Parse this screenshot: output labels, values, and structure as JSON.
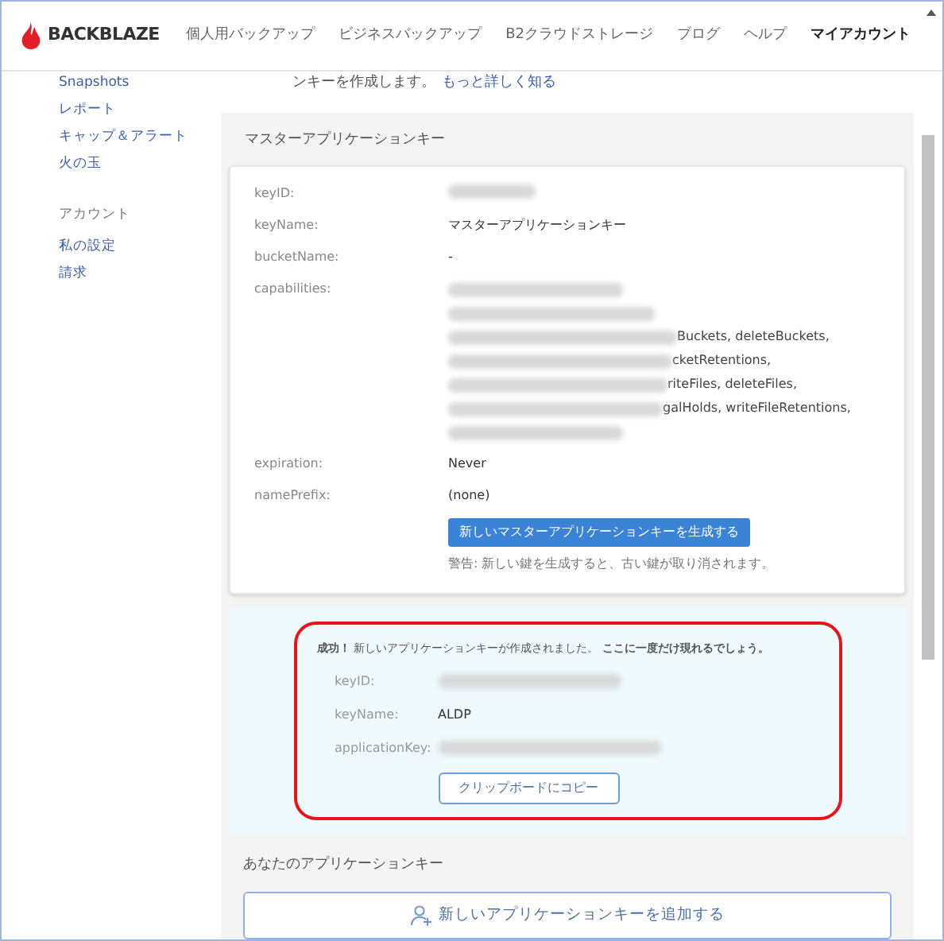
{
  "header": {
    "logo": "BACKBLAZE",
    "nav": [
      {
        "label": "個人用バックアップ",
        "selected": false
      },
      {
        "label": "ビジネスバックアップ",
        "selected": false
      },
      {
        "label": "B2クラウドストレージ",
        "selected": false
      },
      {
        "label": "ブログ",
        "selected": false
      },
      {
        "label": "ヘルプ",
        "selected": false
      },
      {
        "label": "マイアカウント",
        "selected": true
      }
    ]
  },
  "sidebar": {
    "groups": [
      {
        "items": [
          "Snapshots",
          "レポート",
          "キャップ＆アラート",
          "火の玉"
        ]
      },
      {
        "heading": "アカウント",
        "items": [
          "私の設定",
          "請求"
        ]
      }
    ]
  },
  "intro": {
    "text": "ンキーを作成します。",
    "link": "もっと詳しく知る"
  },
  "master_key": {
    "title": "マスターアプリケーションキー",
    "fields": [
      {
        "label": "keyID:",
        "kind": "redacted"
      },
      {
        "label": "keyName:",
        "kind": "text",
        "value": "マスターアプリケーションキー"
      },
      {
        "label": "bucketName:",
        "kind": "text",
        "value": "-"
      },
      {
        "label": "capabilities:",
        "kind": "lines",
        "lines": [
          {
            "kind": "redacted"
          },
          {
            "kind": "redacted"
          },
          {
            "kind": "partial",
            "visible": "Buckets, deleteBuckets,"
          },
          {
            "kind": "partial",
            "visible": "cketRetentions,"
          },
          {
            "kind": "partial",
            "visible": "riteFiles, deleteFiles,"
          },
          {
            "kind": "partial",
            "visible": "galHolds, writeFileRetentions,"
          },
          {
            "kind": "redacted"
          }
        ]
      },
      {
        "label": "expiration:",
        "kind": "text",
        "value": "Never"
      },
      {
        "label": "namePrefix:",
        "kind": "text",
        "value": "(none)"
      }
    ],
    "button": "新しいマスターアプリケーションキーを生成する",
    "warning": "警告: 新しい鍵を生成すると、古い鍵が取り消されます。"
  },
  "success": {
    "message": "**成功！** 新しいアプリケーションキーが作成されました。 **ここに一度だけ現れるでしょう。**",
    "fields": [
      {
        "label": "keyID:",
        "kind": "redacted"
      },
      {
        "label": "keyName:",
        "kind": "text",
        "value": "ALDP"
      },
      {
        "label": "applicationKey:",
        "kind": "redacted"
      }
    ],
    "button": "クリップボードにコピー"
  },
  "your_keys": {
    "title": "あなたのアプリケーションキー",
    "add_button": "新しいアプリケーションキーを追加する"
  }
}
